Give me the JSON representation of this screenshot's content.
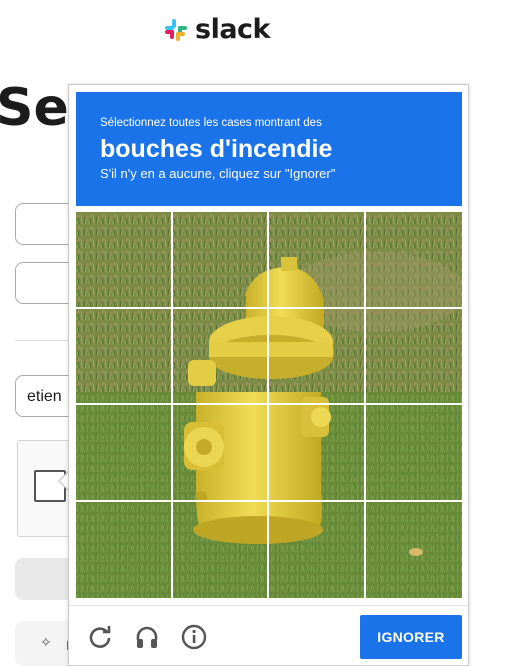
{
  "slack": {
    "brand_name": "slack",
    "heading": "Se c",
    "email_value": "etien",
    "footer_letter": "I"
  },
  "challenge": {
    "instruction": "Sélectionnez toutes les cases montrant des",
    "target": "bouches d'incendie",
    "hint": "S'il n'y en a aucune, cliquez sur \"Ignorer\"",
    "grid": {
      "rows": 4,
      "cols": 4
    },
    "footer": {
      "reload_icon": "reload-icon",
      "audio_icon": "headphones-icon",
      "info_icon": "info-icon",
      "skip_label": "IGNORER"
    }
  },
  "colors": {
    "accent": "#1a73e8",
    "hydrant": "#e3cf3c",
    "grass": "#6e8a3a"
  }
}
